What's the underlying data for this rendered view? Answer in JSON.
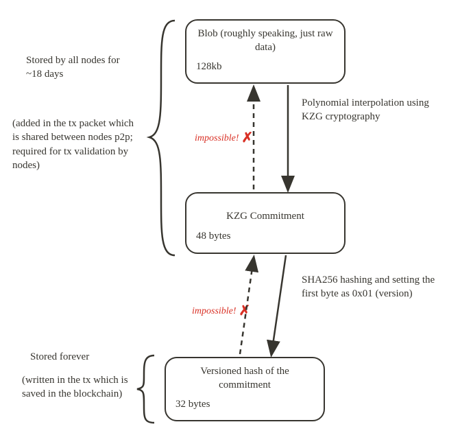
{
  "boxes": {
    "blob": {
      "title": "Blob (roughly speaking, just raw data)",
      "size": "128kb"
    },
    "kzg": {
      "title": "KZG Commitment",
      "size": "48 bytes"
    },
    "hash": {
      "title": "Versioned hash of the commitment",
      "size": "32 bytes"
    }
  },
  "annotations": {
    "top_bracket_1": "Stored by all nodes for ~18 days",
    "top_bracket_2": "(added in the tx packet which is shared between nodes p2p; required for tx validation by nodes)",
    "bottom_bracket_1": "Stored forever",
    "bottom_bracket_2": "(written in the tx which is saved in the blockchain)",
    "arrow_right_1": "Polynomial interpolation using KZG cryptography",
    "arrow_right_2": "SHA256 hashing and setting the first byte as 0x01 (version)",
    "impossible_1": "impossible!",
    "impossible_2": "impossible!",
    "x_mark": "✗"
  }
}
